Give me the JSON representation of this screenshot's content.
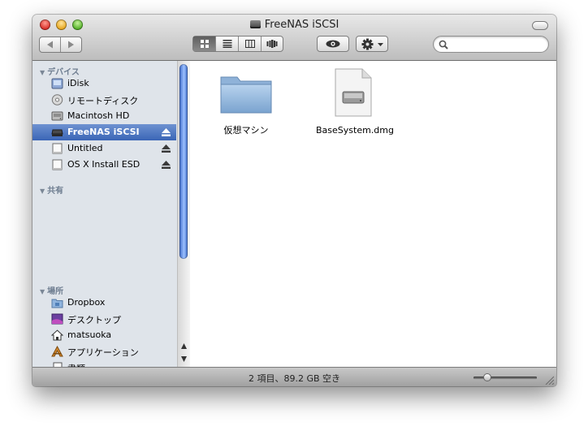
{
  "window": {
    "title": "FreeNAS iSCSI"
  },
  "toolbar": {
    "views": [
      "icon",
      "list",
      "column",
      "coverflow"
    ],
    "active_view": "icon",
    "search_placeholder": ""
  },
  "sidebar": {
    "sections": [
      {
        "title": "デバイス",
        "items": [
          {
            "label": "iDisk",
            "icon": "idisk-icon",
            "eject": false
          },
          {
            "label": "リモートディスク",
            "icon": "remote-disc-icon",
            "eject": false
          },
          {
            "label": "Macintosh HD",
            "icon": "hard-drive-icon",
            "eject": false
          },
          {
            "label": "FreeNAS iSCSI",
            "icon": "drive-icon",
            "eject": true,
            "selected": true
          },
          {
            "label": "Untitled",
            "icon": "disk-image-icon",
            "eject": true
          },
          {
            "label": "OS X Install ESD",
            "icon": "disk-image-icon",
            "eject": true
          }
        ]
      },
      {
        "title": "共有",
        "items": []
      },
      {
        "title": "場所",
        "items": [
          {
            "label": "Dropbox",
            "icon": "dropbox-folder-icon"
          },
          {
            "label": "デスクトップ",
            "icon": "desktop-icon"
          },
          {
            "label": "matsuoka",
            "icon": "home-icon"
          },
          {
            "label": "アプリケーション",
            "icon": "applications-icon"
          },
          {
            "label": "書類",
            "icon": "documents-icon"
          }
        ]
      }
    ]
  },
  "content": {
    "files": [
      {
        "name": "仮想マシン",
        "icon": "folder-icon"
      },
      {
        "name": "BaseSystem.dmg",
        "icon": "dmg-file-icon"
      }
    ]
  },
  "status": {
    "text": "2 項目、89.2 GB 空き"
  },
  "colors": {
    "selection": "#3a65b6",
    "sidebar_bg": "#dfe4ea",
    "scroll_thumb": "#4f7fd6"
  }
}
